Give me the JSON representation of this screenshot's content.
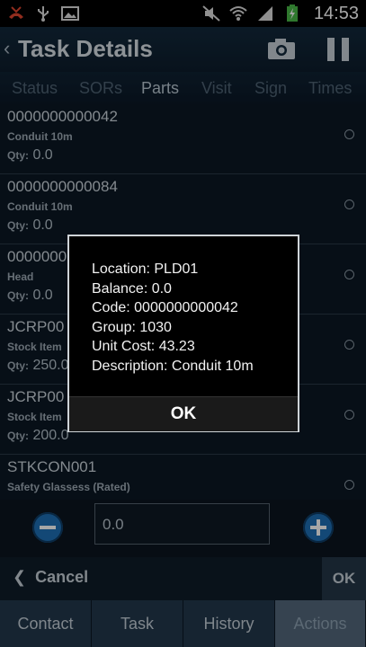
{
  "status_bar": {
    "time": "14:53",
    "icons": [
      "missed-call-icon",
      "usb-icon",
      "gallery-icon",
      "mute-icon",
      "wifi-icon",
      "signal-icon",
      "battery-charging-icon"
    ]
  },
  "header": {
    "title": "Task Details",
    "back_icon": "chevron-left-icon",
    "camera_icon": "camera-icon",
    "pause_icon": "pause-icon"
  },
  "tabs": [
    {
      "label": "Status"
    },
    {
      "label": "SORs"
    },
    {
      "label": "Parts",
      "active": true
    },
    {
      "label": "Visit"
    },
    {
      "label": "Sign"
    },
    {
      "label": "Times"
    }
  ],
  "parts": [
    {
      "code": "0000000000042",
      "desc": "Conduit 10m",
      "qty_label": "Qty:",
      "qty": "0.0"
    },
    {
      "code": "0000000000084",
      "desc": "Conduit 10m",
      "qty_label": "Qty:",
      "qty": "0.0"
    },
    {
      "code": "0000000",
      "desc": "Head",
      "qty_label": "Qty:",
      "qty": "0.0"
    },
    {
      "code": "JCRP00",
      "desc": "Stock Item",
      "qty_label": "Qty:",
      "qty": "250.0"
    },
    {
      "code": "JCRP00",
      "desc": "Stock Item",
      "qty_label": "Qty:",
      "qty": "200.0"
    },
    {
      "code": "STKCON001",
      "desc": "Safety Glassess (Rated)",
      "qty_label": "",
      "qty": ""
    }
  ],
  "quantity": {
    "value": "0.0",
    "minus_icon": "minus-circle-icon",
    "plus_icon": "plus-circle-icon"
  },
  "actions": {
    "cancel_label": "Cancel",
    "ok_label": "OK"
  },
  "bottom_nav": [
    {
      "label": "Contact"
    },
    {
      "label": "Task"
    },
    {
      "label": "History"
    },
    {
      "label": "Actions",
      "active": true
    }
  ],
  "dialog": {
    "lines": [
      "Location: PLD01",
      "Balance: 0.0",
      "Code: 0000000000042",
      "Group: 1030",
      "Unit Cost: 43.23",
      "Description: Conduit 10m"
    ],
    "ok_label": "OK"
  }
}
